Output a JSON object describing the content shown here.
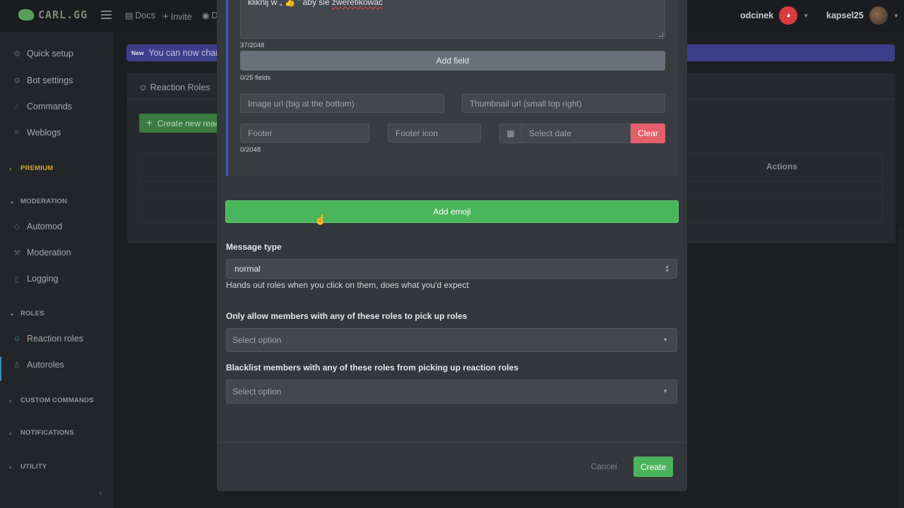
{
  "topbar": {
    "logo_text": "CARL.GG",
    "links": [
      {
        "label": "Docs",
        "icon": "doc-icon"
      },
      {
        "label": "Invite",
        "icon": "plus-icon"
      },
      {
        "label": "D",
        "icon": "discord-icon"
      }
    ],
    "users": [
      {
        "name": "odcinek",
        "avatar": "discord-avatar",
        "color": "#d83c3e"
      },
      {
        "name": "kapsel25",
        "avatar": "user-avatar",
        "color": "#5a4a3a"
      }
    ]
  },
  "sidebar": {
    "items": [
      {
        "label": "Quick setup",
        "icon": "gear-icon"
      },
      {
        "label": "Bot settings",
        "icon": "cog-icon"
      },
      {
        "label": "Commands",
        "icon": "wand-icon"
      },
      {
        "label": "Weblogs",
        "icon": "list-icon"
      },
      {
        "label": "Automod",
        "icon": "shield-icon"
      },
      {
        "label": "Moderation",
        "icon": "hammer-icon"
      },
      {
        "label": "Logging",
        "icon": "file-icon"
      },
      {
        "label": "Reaction roles",
        "icon": "smile-icon"
      },
      {
        "label": "Autoroles",
        "icon": "user-icon"
      }
    ],
    "sections": {
      "premium": "PREMIUM",
      "moderation": "MODERATION",
      "roles": "ROLES",
      "custom_commands": "CUSTOM COMMANDS",
      "notifications": "NOTIFICATIONS",
      "utility": "UTILITY"
    }
  },
  "background": {
    "banner_badge": "New",
    "banner_text": "You can now chang",
    "tab_label": "Reaction Roles",
    "create_button": "Create new reac",
    "table_actions": "Actions"
  },
  "modal": {
    "description_text": "kliknij w „ 👍 ” aby sie ",
    "description_misspelled": "zwerefikowac",
    "description_count": "37/2048",
    "add_field_label": "Add field",
    "fields_count": "0/25 fields",
    "image_url_placeholder": "Image url (big at the bottom)",
    "thumbnail_url_placeholder": "Thumbnail url (small top right)",
    "footer_placeholder": "Footer",
    "footer_icon_placeholder": "Footer icon",
    "date_placeholder": "Select date",
    "clear_label": "Clear",
    "footer_count": "0/2048",
    "add_emoji_label": "Add emoji",
    "message_type_label": "Message type",
    "message_type_value": "normal",
    "message_type_help": "Hands out roles when you click on them, does what you'd expect",
    "allow_roles_label": "Only allow members with any of these roles to pick up roles",
    "allow_roles_placeholder": "Select option",
    "blacklist_label": "Blacklist members with any of these roles from picking up reaction roles",
    "blacklist_placeholder": "Select option",
    "cancel_label": "Cancel",
    "create_label": "Create"
  },
  "colors": {
    "accent_green": "#4ab45a",
    "danger_red": "#e55f6b",
    "embed_blue": "#2b63b5",
    "banner_indigo": "#3e3f8a",
    "premium_gold": "#d4a72c"
  }
}
